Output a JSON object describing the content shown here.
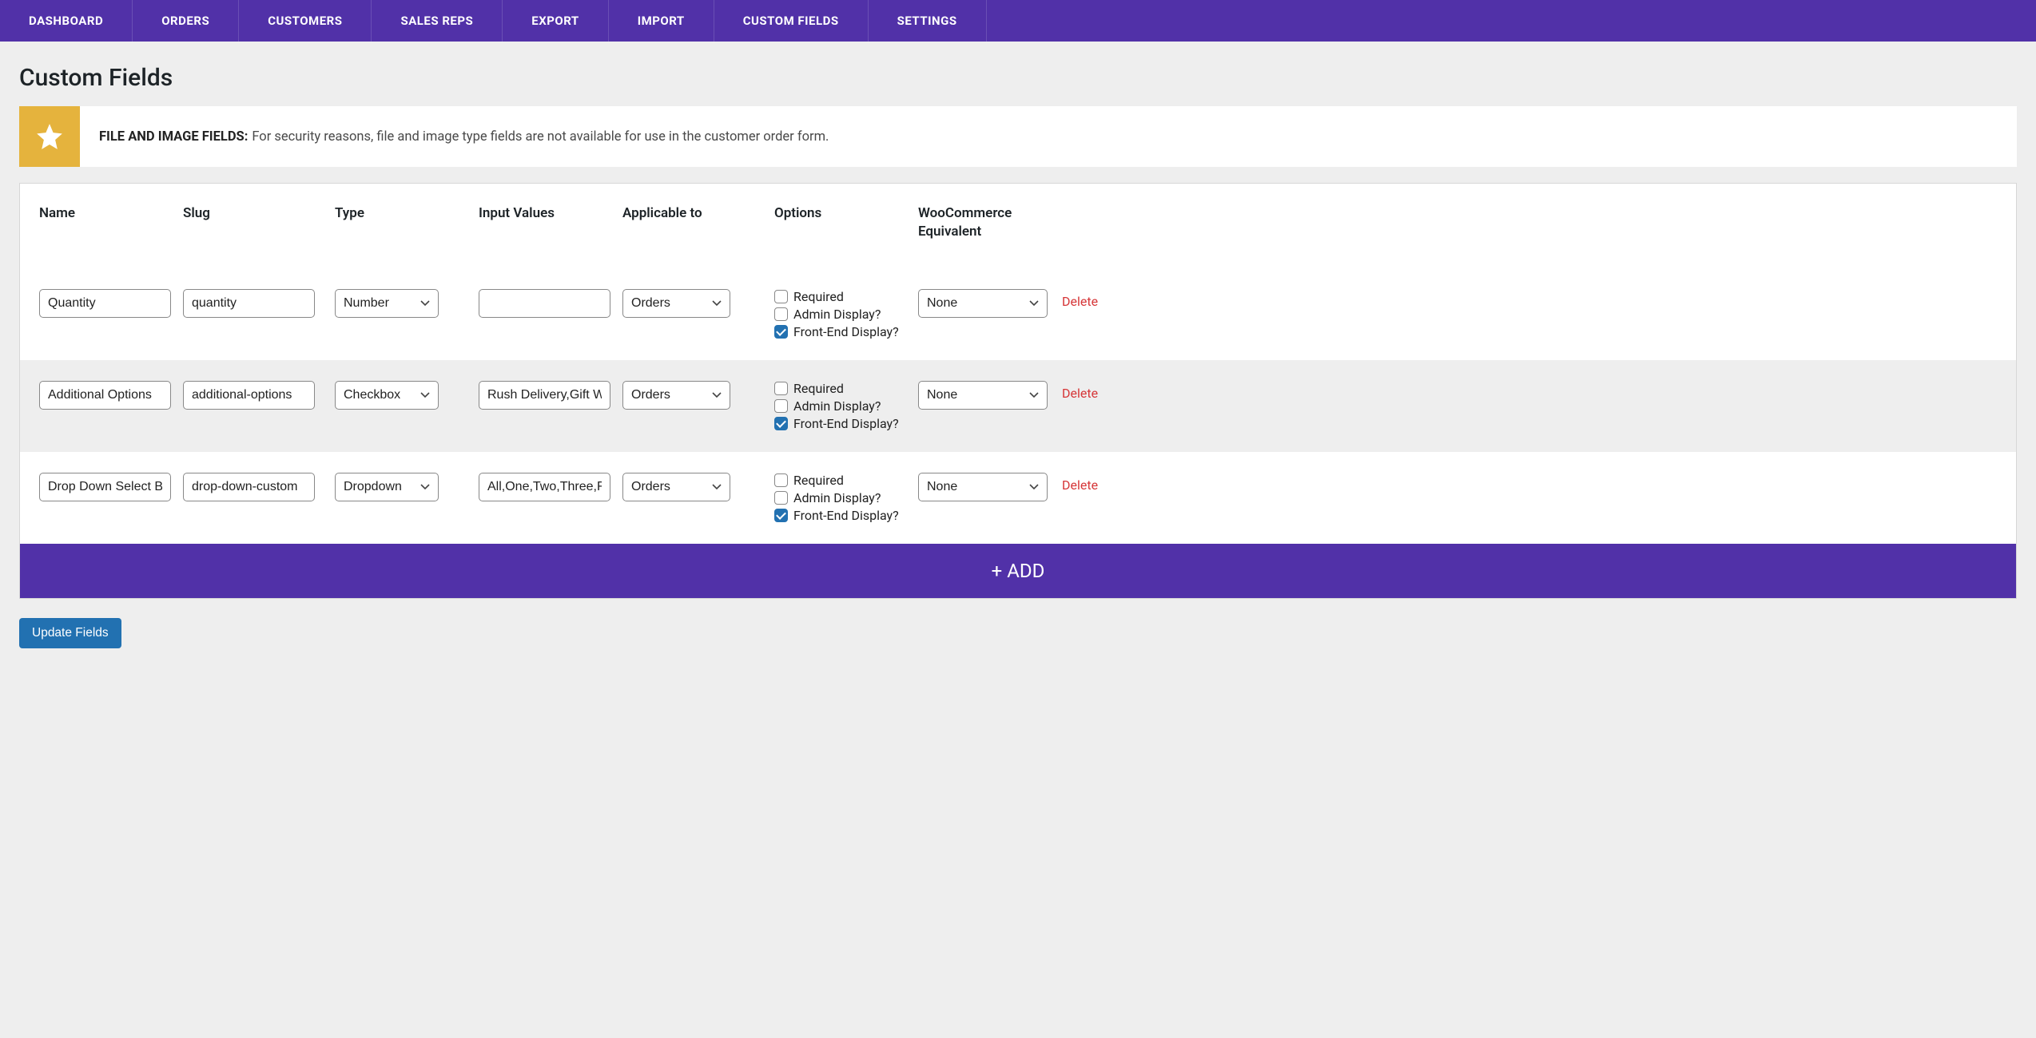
{
  "nav": {
    "items": [
      {
        "label": "DASHBOARD"
      },
      {
        "label": "ORDERS"
      },
      {
        "label": "CUSTOMERS"
      },
      {
        "label": "SALES REPS"
      },
      {
        "label": "EXPORT"
      },
      {
        "label": "IMPORT"
      },
      {
        "label": "CUSTOM FIELDS"
      },
      {
        "label": "SETTINGS"
      }
    ]
  },
  "page": {
    "title": "Custom Fields"
  },
  "notice": {
    "title": "FILE AND IMAGE FIELDS:",
    "text": "For security reasons, file and image type fields are not available for use in the customer order form."
  },
  "table": {
    "headers": {
      "name": "Name",
      "slug": "Slug",
      "type": "Type",
      "input_values": "Input Values",
      "applicable_to": "Applicable to",
      "options": "Options",
      "woo": "WooCommerce Equivalent"
    },
    "option_labels": {
      "required": "Required",
      "admin_display": "Admin Display?",
      "front_end_display": "Front-End Display?"
    },
    "rows": [
      {
        "name": "Quantity",
        "slug": "quantity",
        "type": "Number",
        "input_values": "",
        "applicable_to": "Orders",
        "options": {
          "required": false,
          "admin_display": false,
          "front_end_display": true
        },
        "woo": "None",
        "delete": "Delete"
      },
      {
        "name": "Additional Options",
        "slug": "additional-options",
        "type": "Checkbox",
        "input_values": "Rush Delivery,Gift Wrap",
        "applicable_to": "Orders",
        "options": {
          "required": false,
          "admin_display": false,
          "front_end_display": true
        },
        "woo": "None",
        "delete": "Delete"
      },
      {
        "name": "Drop Down Select Box",
        "slug": "drop-down-custom",
        "type": "Dropdown",
        "input_values": "All,One,Two,Three,Four",
        "applicable_to": "Orders",
        "options": {
          "required": false,
          "admin_display": false,
          "front_end_display": true
        },
        "woo": "None",
        "delete": "Delete"
      }
    ]
  },
  "buttons": {
    "add": "+ ADD",
    "update": "Update Fields"
  }
}
